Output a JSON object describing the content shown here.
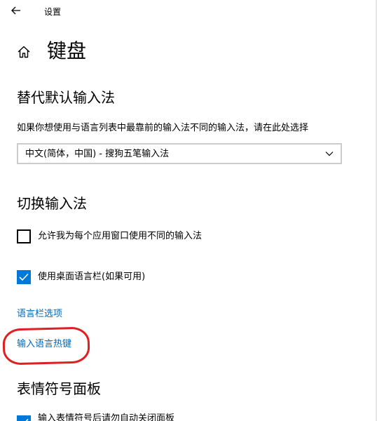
{
  "window": {
    "app_title": "设置",
    "back_icon": "arrow-left-icon"
  },
  "header": {
    "home_icon": "home-icon",
    "title": "键盘"
  },
  "override": {
    "section_title": "替代默认输入法",
    "description": "如果你想使用与语言列表中最靠前的输入法不同的输入法，请在此处选择",
    "selected_value": "中文(简体，中国) - 搜狗五笔输入法"
  },
  "switching": {
    "section_title": "切换输入法",
    "per_app_label": "允许我为每个应用窗口使用不同的输入法",
    "per_app_checked": false,
    "language_bar_label": "使用桌面语言栏(如果可用)",
    "language_bar_checked": true,
    "language_bar_options_link": "语言栏选项",
    "input_hotkeys_link": "输入语言热键"
  },
  "emoji": {
    "section_title": "表情符号面板",
    "partial_checkbox_label": "输入表情符号后请勿自动关闭面板",
    "partial_checkbox_checked": true
  },
  "colors": {
    "accent": "#0078d7",
    "link": "#0067b8",
    "annotation": "#e02020"
  }
}
